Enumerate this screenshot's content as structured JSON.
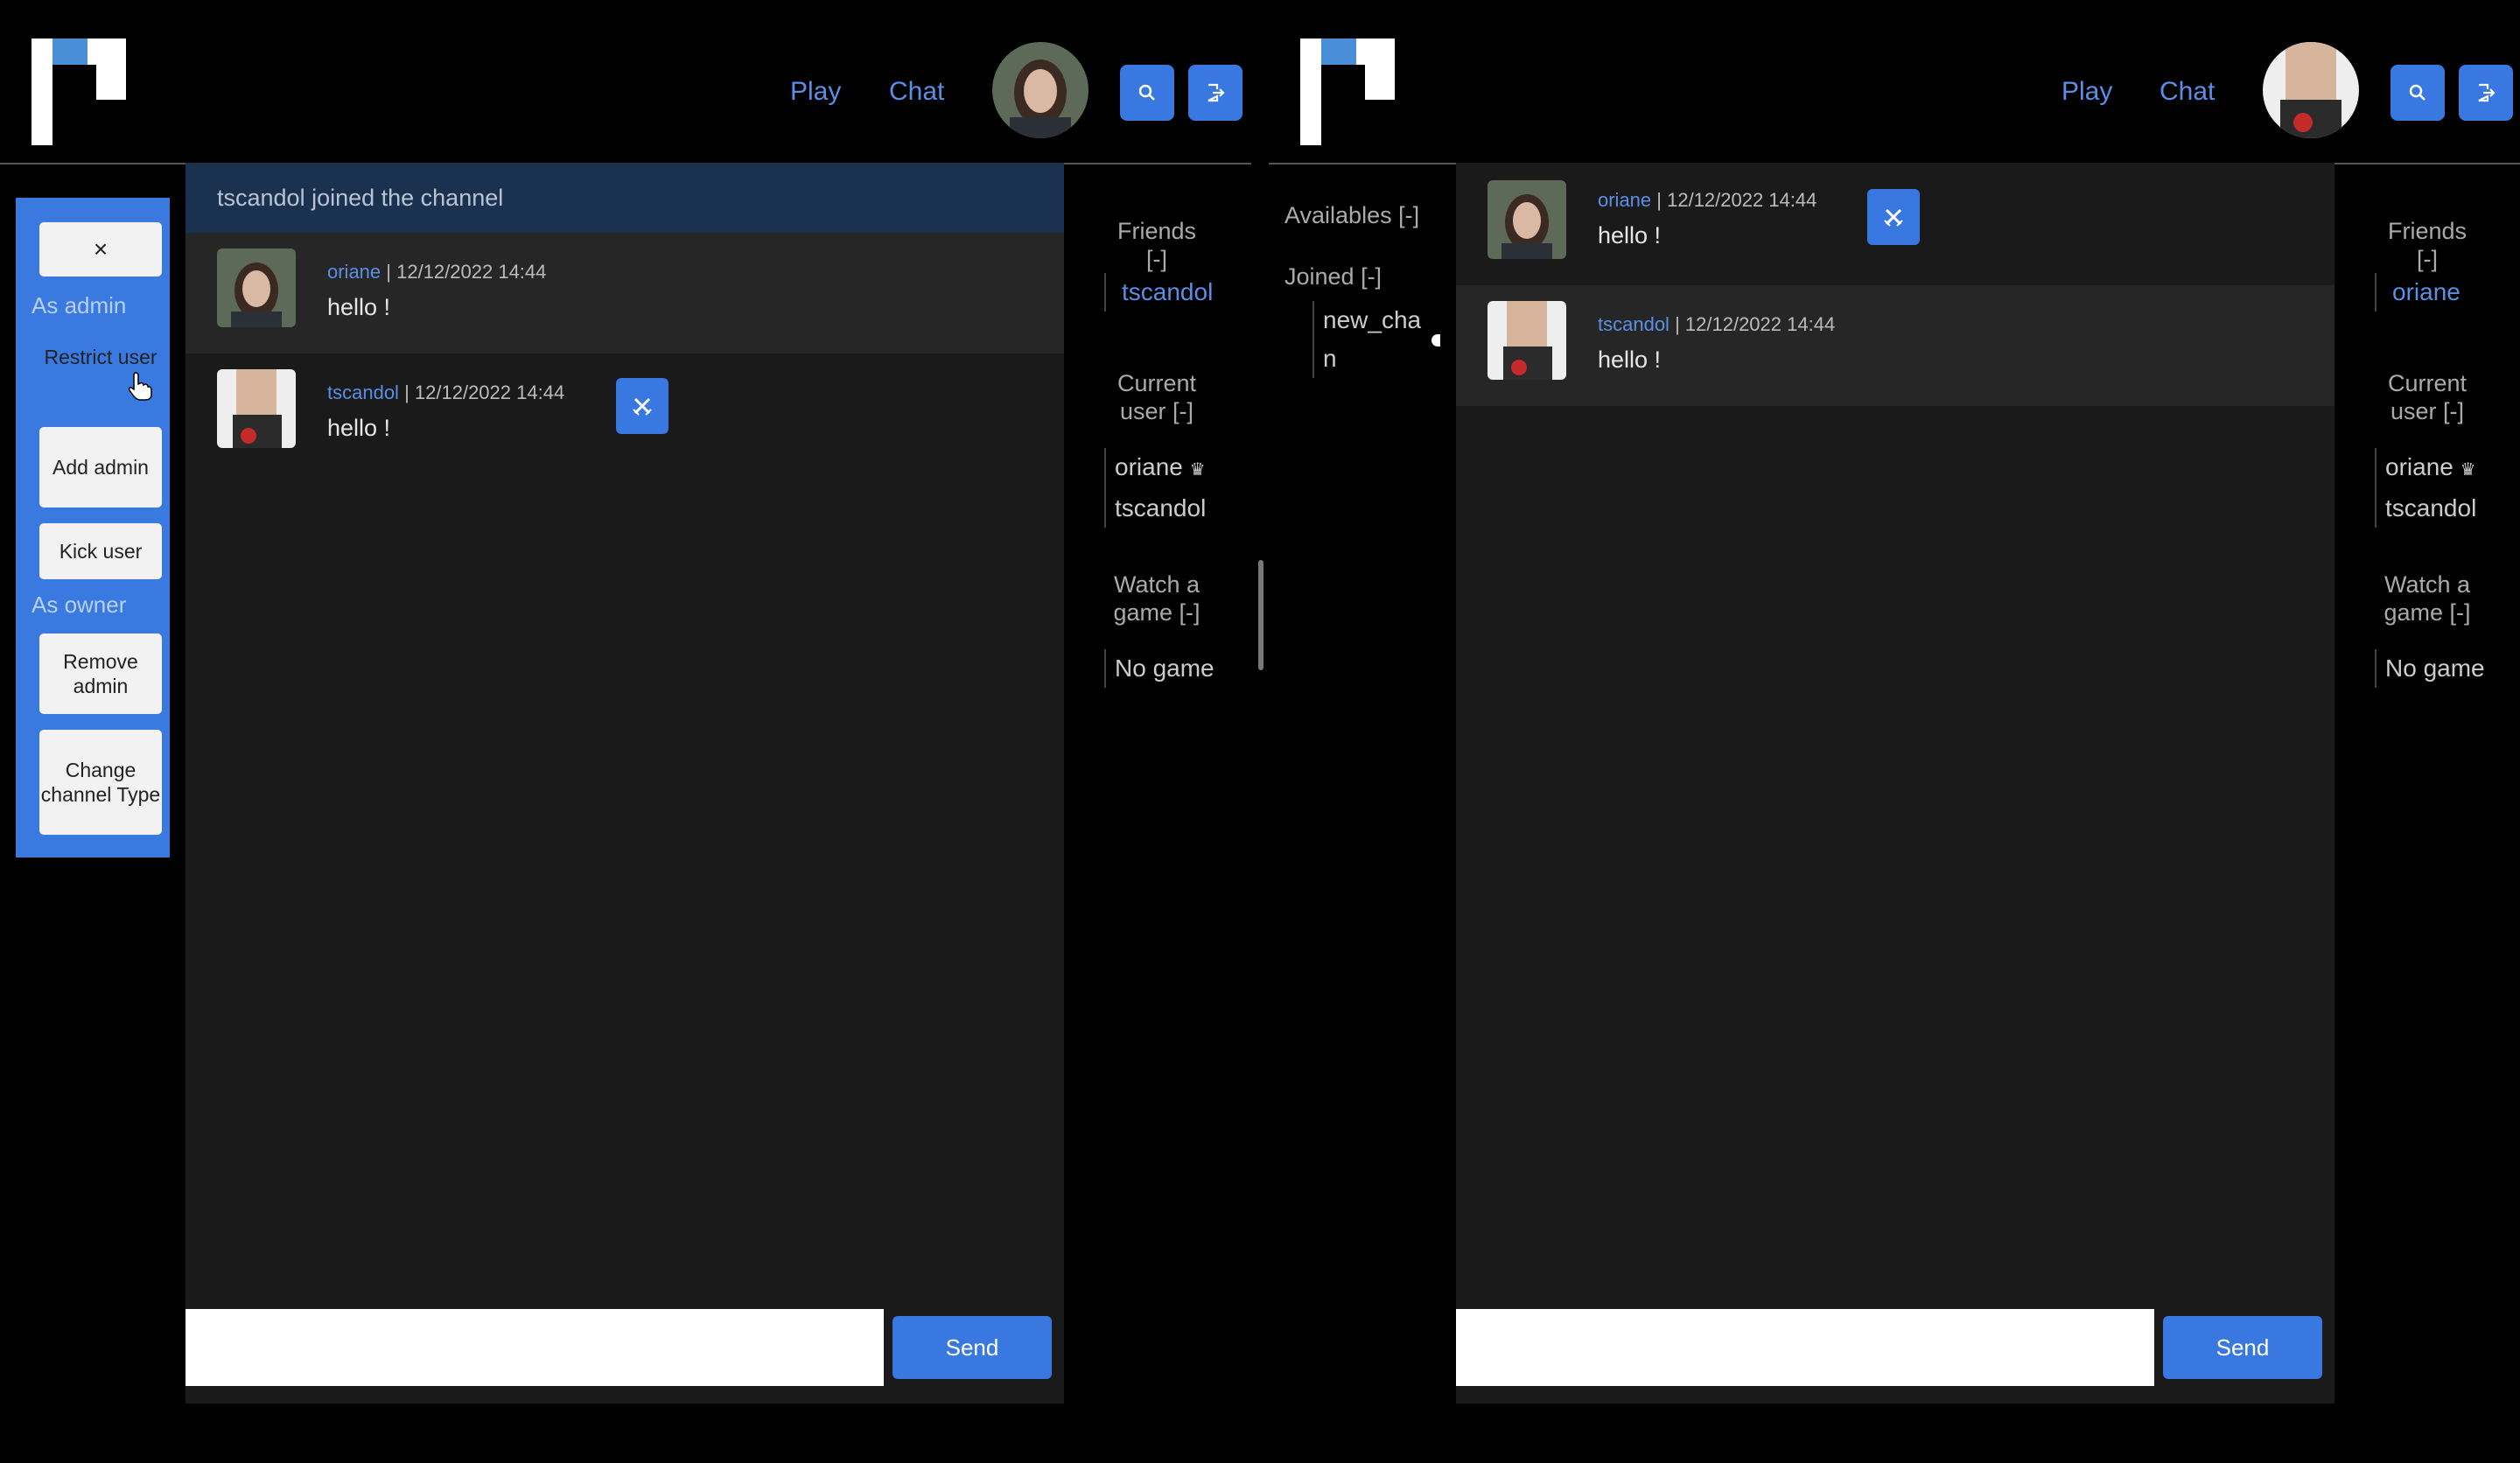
{
  "left": {
    "nav": {
      "play": "Play",
      "chat": "Chat"
    },
    "system_message": "tscandol joined the channel",
    "messages": [
      {
        "user": "oriane",
        "sep": " | ",
        "time": "12/12/2022 14:44",
        "text": "hello !"
      },
      {
        "user": "tscandol",
        "sep": " | ",
        "time": "12/12/2022 14:44",
        "text": "hello !"
      }
    ],
    "admin_panel": {
      "close": "×",
      "as_admin": "As admin",
      "restrict_user": "Restrict user",
      "add_admin": "Add admin",
      "kick_user": "Kick user",
      "as_owner": "As owner",
      "remove_admin": "Remove admin",
      "change_channel_type": "Change channel Type"
    },
    "sidebar": {
      "friends_heading": "Friends [-]",
      "friends": [
        "tscandol"
      ],
      "current_user_heading": "Current user [-]",
      "users": [
        "oriane",
        "tscandol"
      ],
      "owner_mark": "♛",
      "watch_heading": "Watch a game [-]",
      "games": [
        "No game"
      ]
    },
    "send": "Send"
  },
  "right": {
    "nav": {
      "play": "Play",
      "chat": "Chat"
    },
    "channels": {
      "availables": "Availables [-]",
      "joined": "Joined [-]",
      "joined_items": [
        "new_cha",
        "n"
      ]
    },
    "messages": [
      {
        "user": "oriane",
        "sep": " | ",
        "time": "12/12/2022 14:44",
        "text": "hello !"
      },
      {
        "user": "tscandol",
        "sep": " | ",
        "time": "12/12/2022 14:44",
        "text": "hello !"
      }
    ],
    "sidebar": {
      "friends_heading": "Friends [-]",
      "friends": [
        "oriane"
      ],
      "current_user_heading": "Current user [-]",
      "users": [
        "oriane",
        "tscandol"
      ],
      "owner_mark": "♛",
      "watch_heading": "Watch a game [-]",
      "games": [
        "No game"
      ]
    },
    "send": "Send"
  },
  "colors": {
    "accent": "#3978e0",
    "link": "#5b8fe6",
    "logo_blue": "#4b8ed8"
  }
}
